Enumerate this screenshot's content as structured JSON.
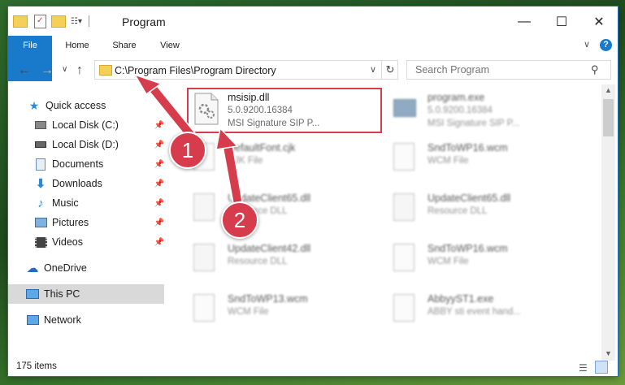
{
  "window": {
    "title": "Program",
    "minimize": "—",
    "maximize": "☐",
    "close": "✕"
  },
  "ribbon": {
    "tabs": [
      "File",
      "Home",
      "Share",
      "View"
    ]
  },
  "address_bar": {
    "path": "C:\\Program Files\\Program Directory",
    "search_placeholder": "Search Program"
  },
  "nav_pane": {
    "quick_access": "Quick access",
    "items": [
      {
        "label": "Local Disk (C:)"
      },
      {
        "label": "Local Disk (D:)"
      },
      {
        "label": "Documents"
      },
      {
        "label": "Downloads"
      },
      {
        "label": "Music"
      },
      {
        "label": "Pictures"
      },
      {
        "label": "Videos"
      }
    ],
    "onedrive": "OneDrive",
    "this_pc": "This PC",
    "network": "Network"
  },
  "files": [
    {
      "name": "msisip.dll",
      "line2": "5.0.9200.16384",
      "line3": "MSI Signature SIP P..."
    },
    {
      "name": "program.exe",
      "line2": "5.0.9200.16384",
      "line3": "MSI Signature SIP P..."
    },
    {
      "name": "DefaultFont.cjk",
      "line2": "CJK File",
      "line3": ""
    },
    {
      "name": "SndToWP16.wcm",
      "line2": "WCM File",
      "line3": ""
    },
    {
      "name": "UpdateClient65.dll",
      "line2": "Resource DLL",
      "line3": ""
    },
    {
      "name": "UpdateClient65.dll",
      "line2": "Resource DLL",
      "line3": ""
    },
    {
      "name": "UpdateClient42.dll",
      "line2": "Resource DLL",
      "line3": ""
    },
    {
      "name": "SndToWP16.wcm",
      "line2": "WCM File",
      "line3": ""
    },
    {
      "name": "SndToWP13.wcm",
      "line2": "WCM File",
      "line3": ""
    },
    {
      "name": "AbbyyST1.exe",
      "line2": "ABBY sti event hand...",
      "line3": ""
    }
  ],
  "status": {
    "item_count": "175 items"
  },
  "annotations": [
    "1",
    "2"
  ],
  "colors": {
    "accent": "#1979ca",
    "highlight": "#d63c4b"
  }
}
